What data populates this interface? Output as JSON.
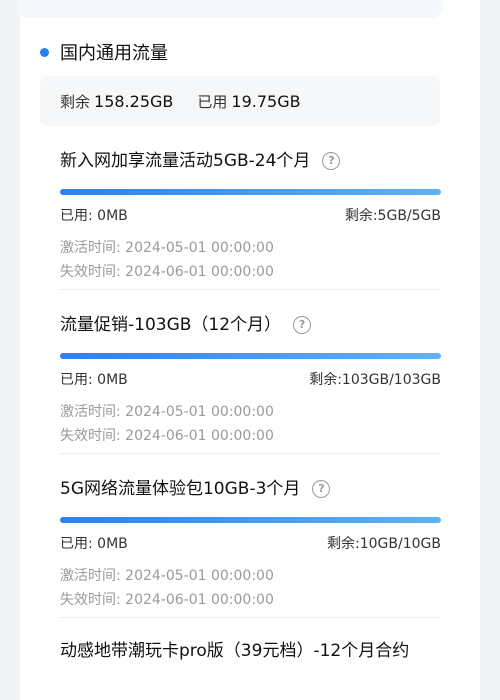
{
  "section": {
    "title": "国内通用流量"
  },
  "summary": {
    "remaining_label": "剩余",
    "remaining_value": "158.25GB",
    "used_label": "已用",
    "used_value": "19.75GB"
  },
  "packages": [
    {
      "title": "新入网加享流量活动5GB-24个月",
      "used": "已用: 0MB",
      "remaining": "剩余:5GB/5GB",
      "remaining_fraction": 1.0,
      "activation": "激活时间: 2024-05-01 00:00:00",
      "expiry": "失效时间: 2024-06-01 00:00:00"
    },
    {
      "title": "流量促销-103GB（12个月）",
      "used": "已用: 0MB",
      "remaining": "剩余:103GB/103GB",
      "remaining_fraction": 1.0,
      "activation": "激活时间: 2024-05-01 00:00:00",
      "expiry": "失效时间: 2024-06-01 00:00:00"
    },
    {
      "title": "5G网络流量体验包10GB-3个月",
      "used": "已用: 0MB",
      "remaining": "剩余:10GB/10GB",
      "remaining_fraction": 1.0,
      "activation": "激活时间: 2024-05-01 00:00:00",
      "expiry": "失效时间: 2024-06-01 00:00:00"
    },
    {
      "title": "动感地带潮玩卡pro版（39元档）-12个月合约"
    }
  ],
  "icons": {
    "help": "help-circle-icon",
    "bullet": "bullet-dot-icon"
  },
  "colors": {
    "accent": "#1f82ee",
    "bar_start": "#2f7ff0",
    "bar_end": "#5fb3f2"
  }
}
